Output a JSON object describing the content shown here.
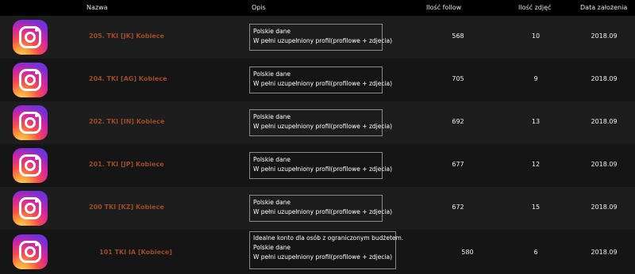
{
  "columns": {
    "name": "Nazwa",
    "desc": "Opis",
    "follow": "Ilość follow",
    "photos": "Ilość zdjęć",
    "date": "Data założenia"
  },
  "rows": [
    {
      "name": "205. TKI [JK] Kobiece",
      "desc": [
        "Polskie dane",
        "W pełni uzupełniony profil(profilowe + zdjecia)"
      ],
      "follow": "568",
      "photos": "10",
      "date": "2018.09"
    },
    {
      "name": "204. TKI [AG] Kobiece",
      "desc": [
        "Polskie dane",
        "W pełni uzupełniony profil(profilowe + zdjecia)"
      ],
      "follow": "705",
      "photos": "9",
      "date": "2018.09"
    },
    {
      "name": "202. TKI [IN] Kobiece",
      "desc": [
        "Polskie dane",
        "W pełni uzupełniony profil(profilowe + zdjecia)"
      ],
      "follow": "692",
      "photos": "13",
      "date": "2018.09"
    },
    {
      "name": "201. TKI [JP] Kobiece",
      "desc": [
        "Polskie dane",
        "W pełni uzupełniony profil(profilowe + zdjecia)"
      ],
      "follow": "677",
      "photos": "12",
      "date": "2018.09"
    },
    {
      "name": "200 TKI [KZ] Kobiece",
      "desc": [
        "Polskie dane",
        "W pełni uzupełniony profil(profilowe + zdjecia)"
      ],
      "follow": "672",
      "photos": "15",
      "date": "2018.09"
    },
    {
      "name": "101 TKI IA [Kobiece]",
      "desc": [
        "Idealne konto dla osób z ograniczonym budżetem.",
        "Polskie dane",
        "W pełni uzupełniony profil(profilowe + zdjecia)"
      ],
      "follow": "580",
      "photos": "6",
      "date": "2018.09"
    }
  ],
  "colors": {
    "name_link": "#9a4b27",
    "row_bg": "#1d1d1d",
    "header_bg": "#000000"
  },
  "icons": {
    "row_logo": "instagram-icon"
  }
}
